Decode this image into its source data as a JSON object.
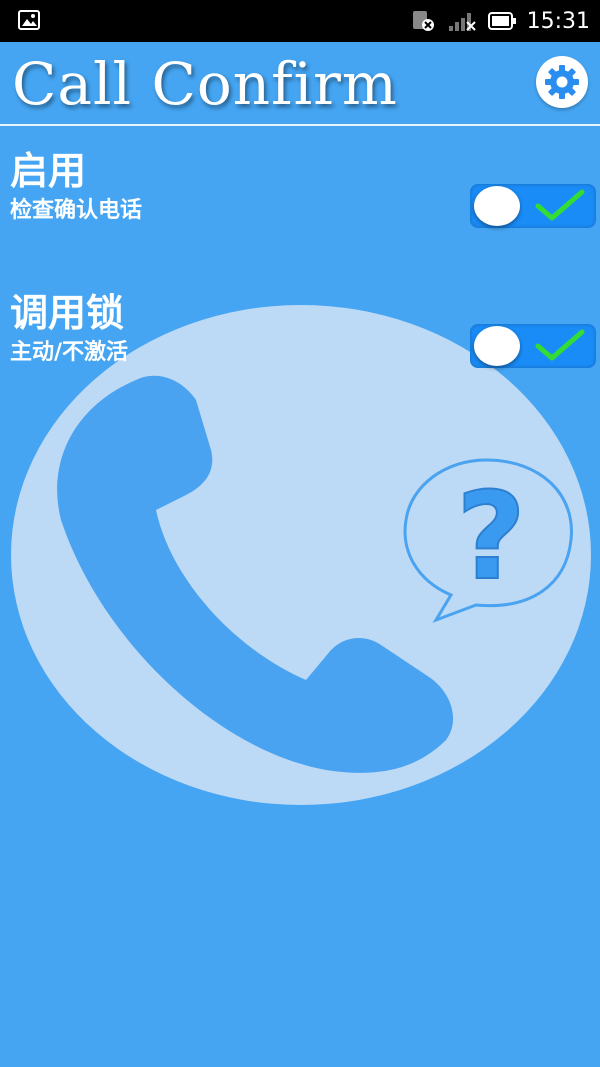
{
  "status_bar": {
    "time": "15:31",
    "icons": [
      "image-notification-icon",
      "sim-error-icon",
      "signal-icon",
      "battery-icon"
    ]
  },
  "header": {
    "title": "Call Confirm",
    "settings_icon": "gear-icon"
  },
  "settings": [
    {
      "title": "启用",
      "subtitle": "检查确认电话",
      "enabled": true
    },
    {
      "title": "调用锁",
      "subtitle": "主动/不激活",
      "enabled": true
    }
  ],
  "colors": {
    "background": "#45a5f2",
    "toggle_on": "#1a8cf7",
    "check": "#33dd33",
    "circle": "#bcd9f5",
    "phone": "#4aa3f0"
  }
}
